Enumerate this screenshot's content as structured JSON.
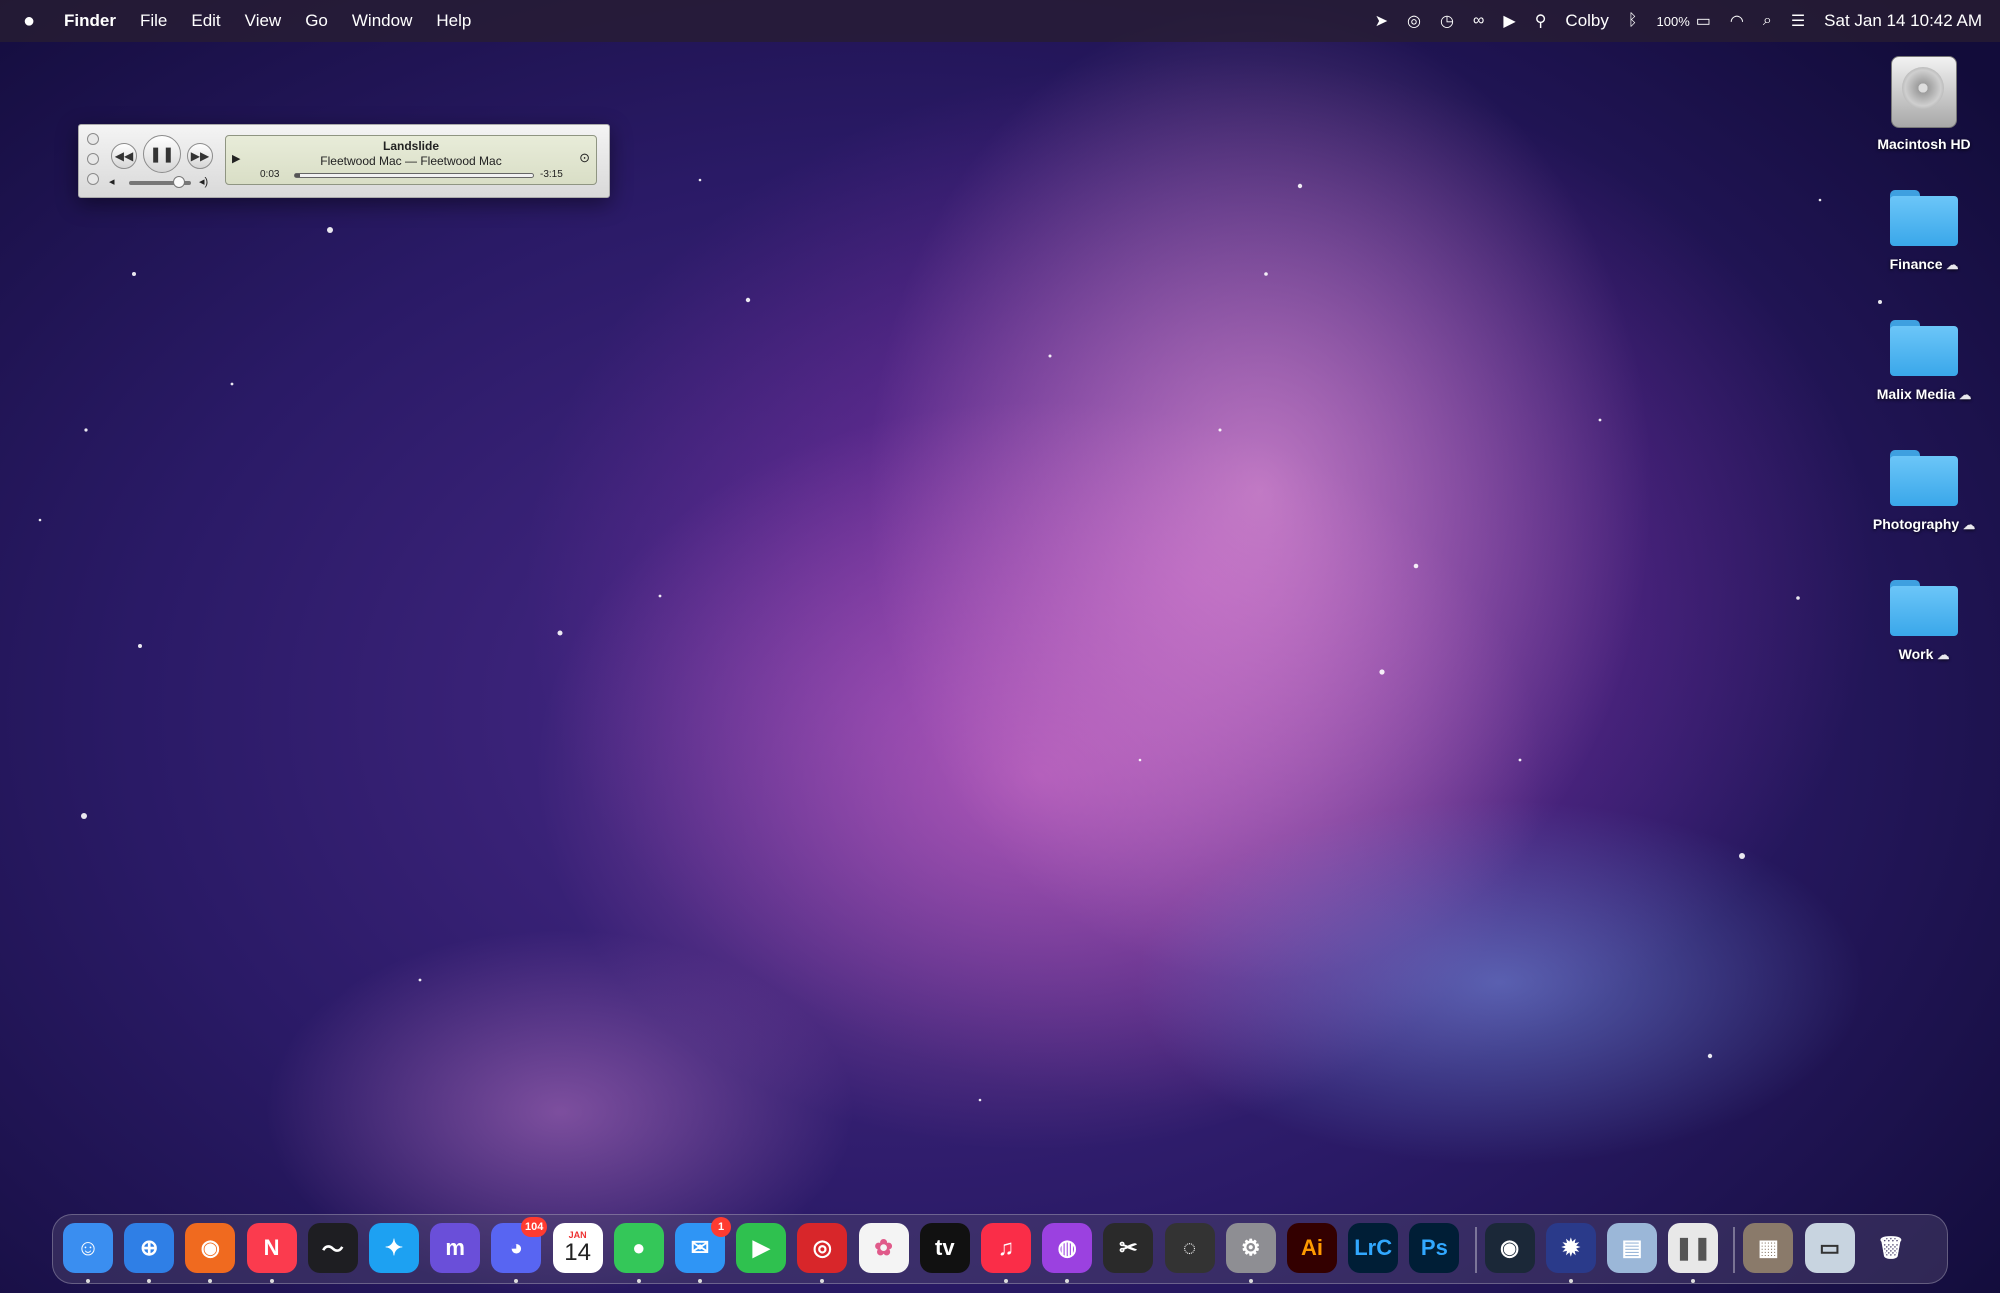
{
  "menubar": {
    "apple_icon": "apple-icon",
    "app_name": "Finder",
    "menus": [
      "File",
      "Edit",
      "View",
      "Go",
      "Window",
      "Help"
    ],
    "user_name": "Colby",
    "battery_percent": "100%",
    "datetime": "Sat Jan 14  10:42 AM"
  },
  "mini_player": {
    "track_title": "Landslide",
    "artist_album": "Fleetwood Mac — Fleetwood Mac",
    "elapsed": "0:03",
    "remaining": "-3:15",
    "progress_fraction": 0.02,
    "volume_fraction": 0.8
  },
  "desktop": {
    "items": [
      {
        "label": "Macintosh HD",
        "kind": "drive"
      },
      {
        "label": "Finance",
        "kind": "folder",
        "cloud_icon": "icloud-icon"
      },
      {
        "label": "Malix Media",
        "kind": "folder",
        "cloud_icon": "icloud-icon"
      },
      {
        "label": "Photography",
        "kind": "folder",
        "cloud_icon": "icloud-icon"
      },
      {
        "label": "Work",
        "kind": "folder",
        "cloud_icon": "icloud-icon"
      }
    ]
  },
  "dock": {
    "apps": [
      {
        "name": "finder",
        "glyph": "☺",
        "color": "#3a8ef0"
      },
      {
        "name": "safari",
        "glyph": "⊕",
        "color": "#2f7fe6"
      },
      {
        "name": "firefox",
        "glyph": "◉",
        "color": "#f06a1f"
      },
      {
        "name": "news",
        "glyph": "N",
        "color": "#fb3b4e"
      },
      {
        "name": "stocks",
        "glyph": "〜",
        "color": "#1e1e22"
      },
      {
        "name": "twitter",
        "glyph": "✦",
        "color": "#1da1f2"
      },
      {
        "name": "mastodon",
        "glyph": "m",
        "color": "#6a4fd9"
      },
      {
        "name": "discord",
        "glyph": "◕",
        "color": "#5865f2",
        "badge": "104"
      },
      {
        "name": "calendar",
        "glyph": "14",
        "color": "#ffffff",
        "text_color": "#222",
        "month": "JAN"
      },
      {
        "name": "messages",
        "glyph": "●",
        "color": "#34c759"
      },
      {
        "name": "mail",
        "glyph": "✉",
        "color": "#2f95f5",
        "badge": "1"
      },
      {
        "name": "facetime",
        "glyph": "▶",
        "color": "#2fc14f"
      },
      {
        "name": "photo-booth",
        "glyph": "◎",
        "color": "#d8262a"
      },
      {
        "name": "photos",
        "glyph": "✿",
        "color": "#f4f4f4",
        "text_color": "#e05a8a"
      },
      {
        "name": "apple-tv",
        "glyph": "tv",
        "color": "#111111"
      },
      {
        "name": "music",
        "glyph": "♫",
        "color": "#fa2d48"
      },
      {
        "name": "podcasts",
        "glyph": "◍",
        "color": "#9b41e0"
      },
      {
        "name": "final-cut-pro",
        "glyph": "✂",
        "color": "#2a2a2a"
      },
      {
        "name": "compressor",
        "glyph": "◌",
        "color": "#333333"
      },
      {
        "name": "system-settings",
        "glyph": "⚙",
        "color": "#8e8e93"
      },
      {
        "name": "illustrator",
        "glyph": "Ai",
        "color": "#330000",
        "text_color": "#ff9a00"
      },
      {
        "name": "lightroom-classic",
        "glyph": "LrC",
        "color": "#001e36",
        "text_color": "#31a8ff"
      },
      {
        "name": "photoshop",
        "glyph": "Ps",
        "color": "#001e36",
        "text_color": "#31a8ff"
      },
      {
        "name": "steam",
        "glyph": "◉",
        "color": "#1b2838"
      },
      {
        "name": "hearthstone",
        "glyph": "✹",
        "color": "#2a3a8a"
      },
      {
        "name": "preview",
        "glyph": "▤",
        "color": "#9bb7d8"
      },
      {
        "name": "pause-app",
        "glyph": "❚❚",
        "color": "#e8e8e8",
        "text_color": "#555"
      },
      {
        "name": "photos-stack",
        "glyph": "▦",
        "color": "#8a7a6a"
      },
      {
        "name": "downloads-stack",
        "glyph": "▭",
        "color": "#c8d4e0",
        "text_color": "#333"
      },
      {
        "name": "trash",
        "glyph": "🗑",
        "color": "transparent"
      }
    ]
  }
}
